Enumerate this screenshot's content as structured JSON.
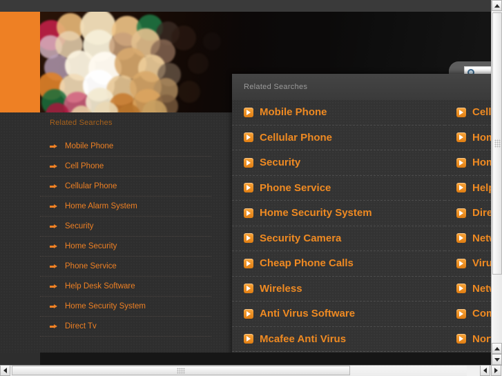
{
  "window": {
    "scrollbars": {
      "vertical_up_icon": "triangle-up-icon",
      "vertical_down_icon": "triangle-down-icon",
      "horizontal_left_icon": "triangle-left-icon",
      "horizontal_right_icon": "triangle-right-icon"
    }
  },
  "hero": {
    "accent_color": "#ee8024",
    "background_color": "#0a0605"
  },
  "search": {
    "icon": "magnifier-icon",
    "value": "",
    "placeholder": ""
  },
  "sidebar": {
    "heading": "Related Searches",
    "bullet_icon": "arrow-right-bullet-icon",
    "items": [
      {
        "label": "Mobile Phone"
      },
      {
        "label": "Cell Phone"
      },
      {
        "label": "Cellular Phone"
      },
      {
        "label": "Home Alarm System"
      },
      {
        "label": "Security"
      },
      {
        "label": "Home Security"
      },
      {
        "label": "Phone Service"
      },
      {
        "label": "Help Desk Software"
      },
      {
        "label": "Home Security System"
      },
      {
        "label": "Direct Tv"
      }
    ]
  },
  "overlay": {
    "heading": "Related Searches",
    "chevron_icon": "chevron-right-badge-icon",
    "link_color": "#ef8a22",
    "columns": [
      {
        "items": [
          {
            "label": "Mobile Phone"
          },
          {
            "label": "Cellular Phone"
          },
          {
            "label": "Security"
          },
          {
            "label": "Phone Service"
          },
          {
            "label": "Home Security System"
          },
          {
            "label": "Security Camera"
          },
          {
            "label": "Cheap Phone Calls"
          },
          {
            "label": "Wireless"
          },
          {
            "label": "Anti Virus Software"
          },
          {
            "label": "Mcafee Anti Virus"
          }
        ]
      },
      {
        "items": [
          {
            "label": "Cell Phone"
          },
          {
            "label": "Home Alarm System"
          },
          {
            "label": "Home Security"
          },
          {
            "label": "Help Desk Software"
          },
          {
            "label": "Direct Tv"
          },
          {
            "label": "Network Security"
          },
          {
            "label": "Virus Protection"
          },
          {
            "label": "Network"
          },
          {
            "label": "Computer Security"
          },
          {
            "label": "Norton Anti Virus"
          }
        ]
      }
    ]
  }
}
